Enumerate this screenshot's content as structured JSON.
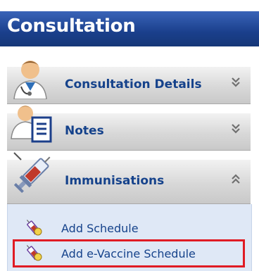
{
  "panel": {
    "title": "Consultation",
    "sections": [
      {
        "label": "Consultation Details",
        "icon": "doctor-icon",
        "expanded": false
      },
      {
        "label": "Notes",
        "icon": "notes-icon",
        "expanded": false
      },
      {
        "label": "Immunisations",
        "icon": "syringe-icon",
        "expanded": true
      }
    ],
    "immunisation_tasks": [
      {
        "label": "Add Schedule",
        "icon": "vaccine-schedule-icon"
      },
      {
        "label": "Add e-Vaccine Schedule",
        "icon": "vaccine-schedule-icon",
        "highlighted": true
      }
    ]
  },
  "colors": {
    "title_bar": "#1a3f8c",
    "section_label": "#15428b",
    "content_bg": "#dfe8f6",
    "highlight": "#e01b24"
  }
}
